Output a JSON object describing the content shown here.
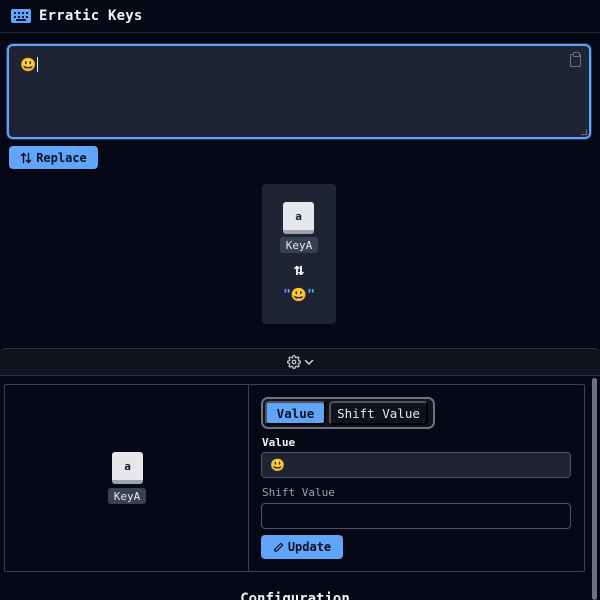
{
  "app": {
    "title": "Erratic Keys"
  },
  "editor": {
    "value": "😃"
  },
  "actions": {
    "replace_label": "Replace"
  },
  "mapping": {
    "key_char": "a",
    "key_code": "KeyA",
    "swap_symbol": "⇅",
    "mapped_value": "\"😃\""
  },
  "config": {
    "key_char": "a",
    "key_code": "KeyA",
    "toggle": {
      "value_label": "Value",
      "shift_label": "Shift Value",
      "selected": "Value"
    },
    "value_label": "Value",
    "value_field": "😃",
    "shift_label": "Shift Value",
    "shift_field": "",
    "update_label": "Update",
    "section_heading": "Configuration"
  },
  "colors": {
    "accent": "#60a5fa",
    "background": "#060816",
    "surface": "#1e2433"
  },
  "icons": [
    "keyboard-icon",
    "clipboard-icon",
    "swap-icon",
    "gear-icon",
    "chevron-down-icon",
    "pencil-icon"
  ]
}
